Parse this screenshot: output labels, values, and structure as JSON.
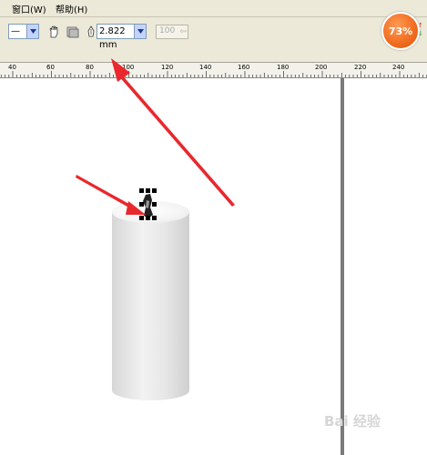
{
  "menu": {
    "window": "窗口(W)",
    "help": "帮助(H)"
  },
  "toolbar": {
    "line_style_value": "—",
    "outline_width_value": "2.822 mm",
    "disabled_value": "100"
  },
  "zoom": {
    "percent": "73%"
  },
  "ruler": {
    "labels": [
      "40",
      "60",
      "80",
      "100",
      "120",
      "140",
      "160",
      "180",
      "200",
      "220",
      "240"
    ]
  },
  "watermark": {
    "text": "Bai 经验"
  },
  "colors": {
    "menu_bg": "#ece9d8",
    "annotation_arrow": "#e8282d",
    "zoom_badge": "#f06b1e"
  }
}
